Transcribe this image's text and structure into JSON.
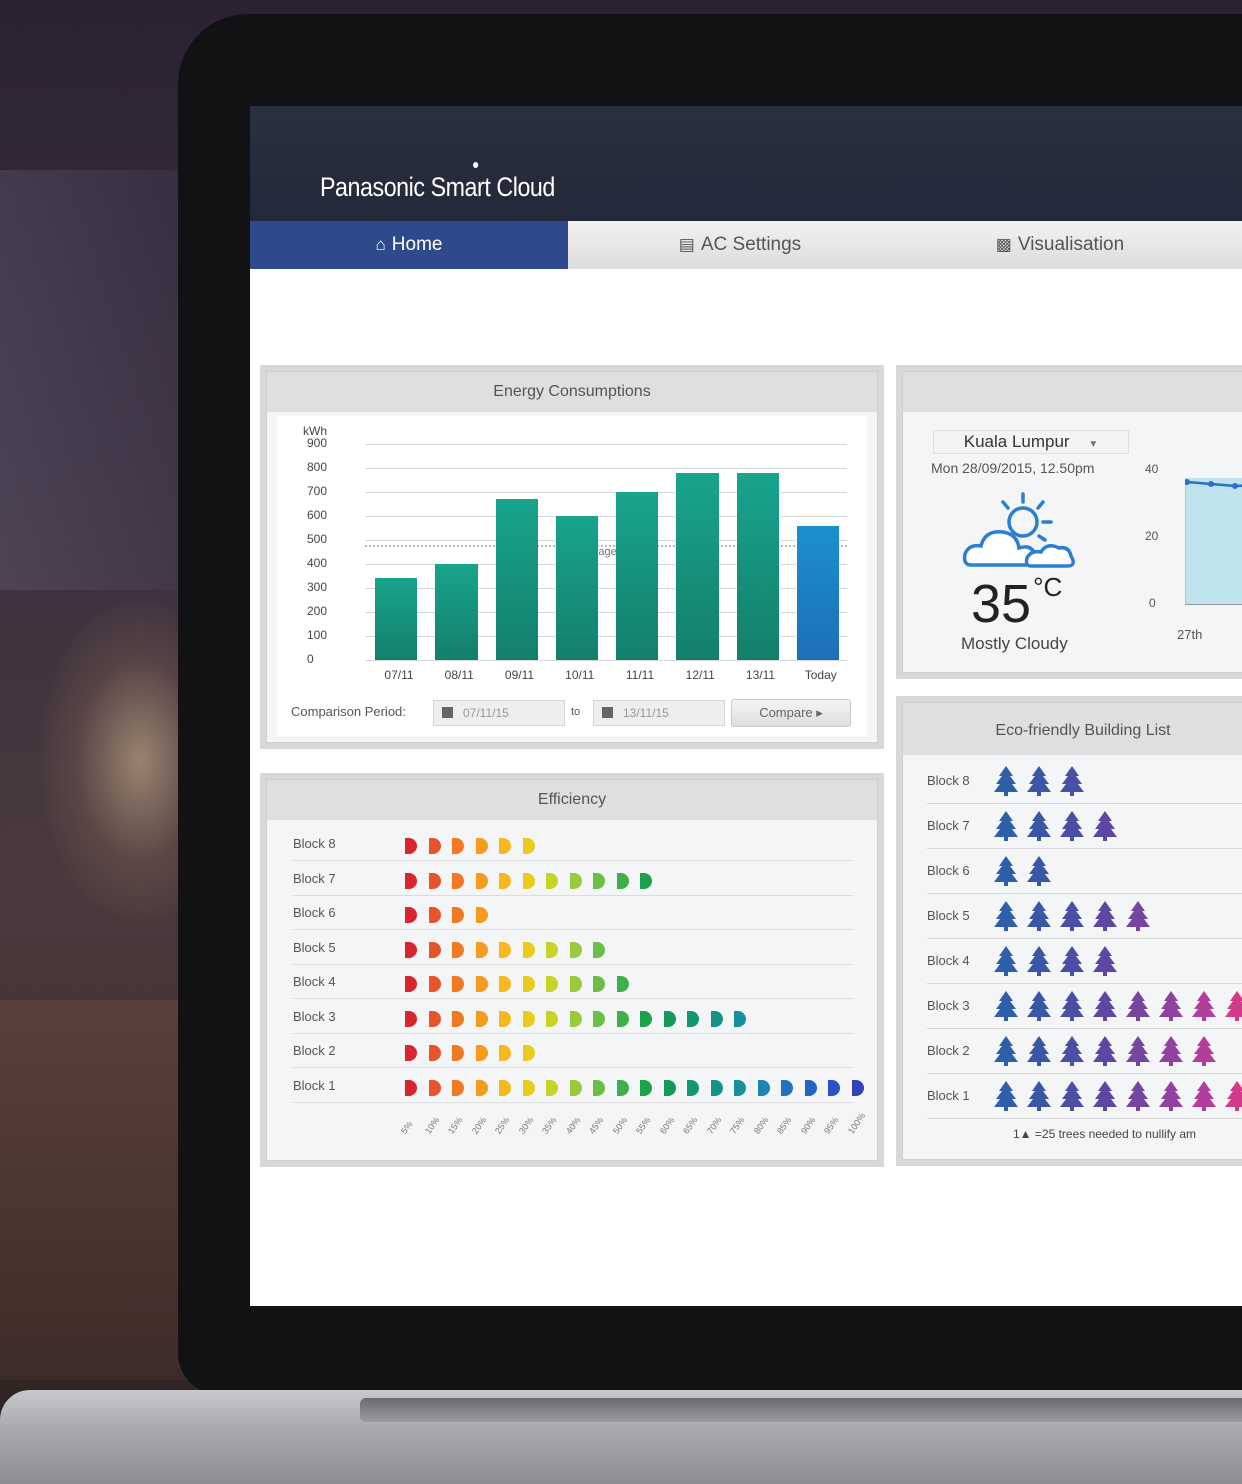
{
  "app": {
    "brand": "Panasonic Smart Cloud"
  },
  "nav": {
    "tabs": [
      {
        "label": "Home",
        "icon": "home-icon",
        "active": true
      },
      {
        "label": "AC Settings",
        "icon": "monitor-icon",
        "active": false
      },
      {
        "label": "Visualisation",
        "icon": "bar-chart-icon",
        "active": false
      }
    ]
  },
  "energy": {
    "title": "Energy Consumptions",
    "comparison_label": "Comparison Period:",
    "from": "07/11/15",
    "to_label": "to",
    "to": "13/11/15",
    "compare_button": "Compare ▸"
  },
  "chart_data": {
    "type": "bar",
    "ylabel": "kWh",
    "ylim": [
      0,
      900
    ],
    "yticks": [
      "900",
      "800",
      "700",
      "600",
      "500",
      "400",
      "300",
      "200",
      "100",
      "0"
    ],
    "categories": [
      "07/11",
      "08/11",
      "09/11",
      "10/11",
      "11/11",
      "12/11",
      "13/11",
      "Today"
    ],
    "values": [
      340,
      400,
      670,
      600,
      700,
      780,
      780,
      560
    ],
    "average_line": 480,
    "average_label": "average",
    "colors": {
      "bar": "#1a9b84",
      "today": "#1f7dc4"
    }
  },
  "efficiency": {
    "title": "Efficiency",
    "rows": [
      {
        "label": "Block 8",
        "count": 6
      },
      {
        "label": "Block 7",
        "count": 11
      },
      {
        "label": "Block 6",
        "count": 4
      },
      {
        "label": "Block 5",
        "count": 9
      },
      {
        "label": "Block 4",
        "count": 10
      },
      {
        "label": "Block 3",
        "count": 15
      },
      {
        "label": "Block 2",
        "count": 6
      },
      {
        "label": "Block 1",
        "count": 20
      }
    ],
    "palette": [
      "#d7262d",
      "#e8542a",
      "#f07a24",
      "#f59c1f",
      "#f6b81c",
      "#e9cc1d",
      "#c6d42a",
      "#9bcb3c",
      "#6cbf45",
      "#3eaf4a",
      "#1ea14f",
      "#16985a",
      "#14966e",
      "#149486",
      "#16909e",
      "#1a84b2",
      "#1f74c0",
      "#2563c7",
      "#2a52c4",
      "#3440b8"
    ],
    "ticks": [
      "5%",
      "10%",
      "15%",
      "20%",
      "25%",
      "30%",
      "35%",
      "40%",
      "45%",
      "50%",
      "55%",
      "60%",
      "65%",
      "70%",
      "75%",
      "80%",
      "85%",
      "90%",
      "95%",
      "100%"
    ]
  },
  "weather": {
    "city": "Kuala Lumpur",
    "datetime": "Mon 28/09/2015, 12.50pm",
    "temperature": "35",
    "unit": "°C",
    "condition": "Mostly Cloudy",
    "yticks": [
      "40",
      "20",
      "0"
    ],
    "xtick": "27th",
    "icon": "partly-cloudy-icon"
  },
  "eco": {
    "title": "Eco-friendly Building List",
    "rows": [
      {
        "label": "Block 8",
        "trees": 3
      },
      {
        "label": "Block 7",
        "trees": 4
      },
      {
        "label": "Block 6",
        "trees": 2
      },
      {
        "label": "Block 5",
        "trees": 5
      },
      {
        "label": "Block 4",
        "trees": 4
      },
      {
        "label": "Block 3",
        "trees": 8
      },
      {
        "label": "Block 2",
        "trees": 7
      },
      {
        "label": "Block 1",
        "trees": 8
      }
    ],
    "tree_colors": [
      "#2f5fa8",
      "#3a57a6",
      "#4a4ea5",
      "#5d47a3",
      "#7446a0",
      "#9142a0",
      "#b23d9c",
      "#d43a8a"
    ],
    "footnote": "1▲ =25 trees needed to nullify am"
  }
}
